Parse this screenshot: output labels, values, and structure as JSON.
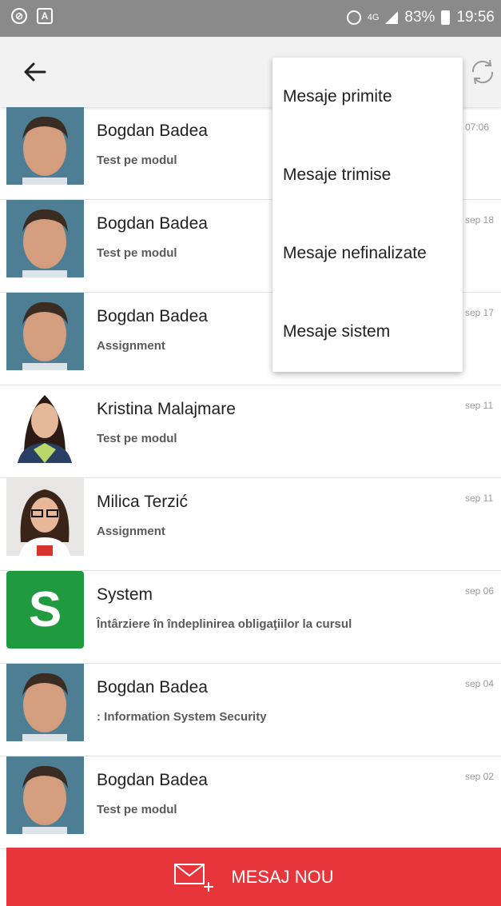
{
  "status_bar": {
    "network": "4G",
    "battery": "83%",
    "time": "19:56"
  },
  "menu": {
    "items": [
      {
        "label": "Mesaje primite"
      },
      {
        "label": "Mesaje trimise"
      },
      {
        "label": "Mesaje nefinalizate"
      },
      {
        "label": "Mesaje sistem"
      }
    ]
  },
  "messages": [
    {
      "name": "Bogdan Badea",
      "subject": "Test pe modul",
      "date": "07:06",
      "avatar": "male-photo"
    },
    {
      "name": "Bogdan Badea",
      "subject": "Test pe modul",
      "date": "sep 18",
      "avatar": "male-photo"
    },
    {
      "name": "Bogdan Badea",
      "subject": "Assignment",
      "date": "sep 17",
      "avatar": "male-photo"
    },
    {
      "name": "Kristina Malajmare",
      "subject": "Test pe modul",
      "date": "sep 11",
      "avatar": "female-photo"
    },
    {
      "name": "Milica Terzić",
      "subject": "Assignment",
      "date": "sep 11",
      "avatar": "female-glasses-photo"
    },
    {
      "name": "System",
      "subject": "Întârziere în îndeplinirea obligaţiilor la cursul",
      "date": "sep 06",
      "avatar": "system",
      "avatar_letter": "S"
    },
    {
      "name": "Bogdan Badea",
      "subject": ": Information System Security",
      "date": "sep 04",
      "avatar": "male-photo"
    },
    {
      "name": "Bogdan Badea",
      "subject": "Test pe modul",
      "date": "sep 02",
      "avatar": "male-photo"
    }
  ],
  "compose": {
    "label": "MESAJ NOU"
  },
  "colors": {
    "accent_red": "#e8343b",
    "system_green": "#1f9a3e",
    "statusbar": "#8a8a8a"
  }
}
